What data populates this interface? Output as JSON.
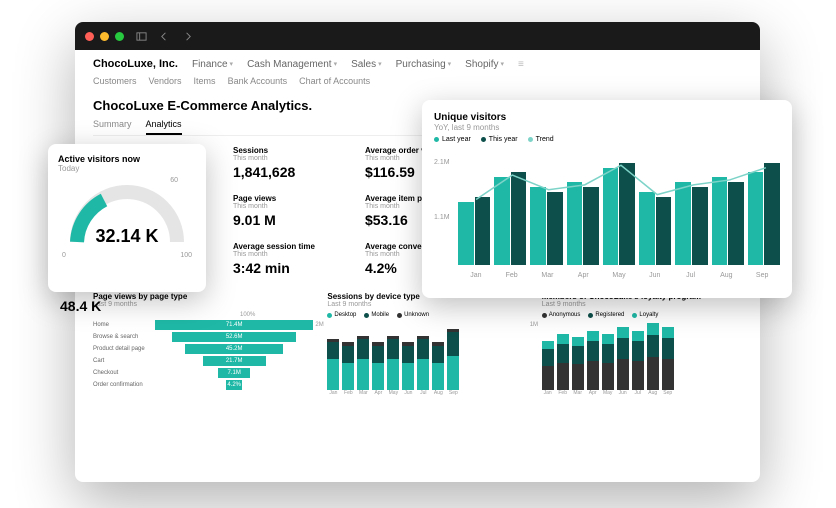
{
  "titlebar": {
    "icons": [
      "sidebar",
      "back",
      "forward"
    ],
    "right": [
      "refresh",
      "share",
      "add",
      "copy"
    ]
  },
  "company": "ChocoLuxe, Inc.",
  "nav": [
    "Finance",
    "Cash Management",
    "Sales",
    "Purchasing",
    "Shopify"
  ],
  "subnav": [
    "Customers",
    "Vendors",
    "Items",
    "Bank Accounts",
    "Chart of Accounts"
  ],
  "page_title": "ChocoLuxe E-Commerce Analytics.",
  "tabs": [
    "Summary",
    "Analytics"
  ],
  "active_tab": 1,
  "gauge": {
    "title": "Active visitors now",
    "sub": "Today",
    "value": "32.14 K",
    "min": "0",
    "mid": "60",
    "max": "100",
    "percent": 32
  },
  "metrics": {
    "col1": [
      {
        "label": "Sessions",
        "sub": "This month",
        "value": "1,841,628"
      },
      {
        "label": "Page views",
        "sub": "This month",
        "value": "9.01 M"
      },
      {
        "label": "Average session time",
        "sub": "This month",
        "value": "3:42 min"
      }
    ],
    "col2": [
      {
        "label": "Average order value",
        "sub": "This month",
        "value": "$116.59"
      },
      {
        "label": "Average item price",
        "sub": "This month",
        "value": "$53.16"
      },
      {
        "label": "Average conversion rate",
        "sub": "This month",
        "value": "4.2%"
      }
    ],
    "left_bottom": {
      "label": "",
      "sub": "",
      "value": "48.4 K"
    }
  },
  "visitors": {
    "title": "Unique visitors",
    "sub": "YoY, last 9 months",
    "legend": [
      "Last year",
      "This year",
      "Trend"
    ],
    "ytick": "2.1M",
    "ytick2": "1.1M",
    "months": [
      "Jan",
      "Feb",
      "Mar",
      "Apr",
      "May",
      "Jun",
      "Jul",
      "Aug",
      "Sep"
    ]
  },
  "funnel": {
    "title": "Page views by page type",
    "sub": "Last 9 months",
    "scale_max": "100%",
    "rows": [
      {
        "label": "Home",
        "value": "71.4M",
        "pct": 100
      },
      {
        "label": "Browse & search",
        "value": "52.6M",
        "pct": 78
      },
      {
        "label": "Product detail page",
        "value": "45.2M",
        "pct": 62
      },
      {
        "label": "Cart",
        "value": "21.7M",
        "pct": 40
      },
      {
        "label": "Checkout",
        "value": "7.1M",
        "pct": 20
      },
      {
        "label": "Order confirmation",
        "value": "4.2%",
        "pct": 10
      }
    ]
  },
  "sessions_device": {
    "title": "Sessions by device type",
    "sub": "Last 9 months",
    "legend": [
      "Desktop",
      "Mobile",
      "Unknown"
    ],
    "ylabel": "2M",
    "months": [
      "Jan",
      "Feb",
      "Mar",
      "Apr",
      "May",
      "Jun",
      "Jul",
      "Aug",
      "Sep"
    ]
  },
  "loyalty": {
    "title": "Members of ChocoLuxe's loyalty program",
    "sub": "Last 9 months",
    "legend": [
      "Anonymous",
      "Registered",
      "Loyalty"
    ],
    "ylabel": "1M",
    "months": [
      "Jan",
      "Feb",
      "Mar",
      "Apr",
      "May",
      "Jun",
      "Jul",
      "Aug",
      "Sep"
    ]
  },
  "chart_data": [
    {
      "type": "bar",
      "title": "Unique visitors",
      "xlabel": "",
      "ylabel": "",
      "ylim": [
        0,
        2.3
      ],
      "categories": [
        "Jan",
        "Feb",
        "Mar",
        "Apr",
        "May",
        "Jun",
        "Jul",
        "Aug",
        "Sep"
      ],
      "series": [
        {
          "name": "Last year",
          "values": [
            1.3,
            1.8,
            1.6,
            1.7,
            2.0,
            1.5,
            1.7,
            1.8,
            1.9
          ]
        },
        {
          "name": "This year",
          "values": [
            1.4,
            1.9,
            1.5,
            1.6,
            2.1,
            1.4,
            1.6,
            1.7,
            2.1
          ]
        }
      ],
      "trend": [
        1.35,
        1.85,
        1.55,
        1.65,
        2.05,
        1.45,
        1.65,
        1.75,
        2.0
      ]
    },
    {
      "type": "bar",
      "title": "Sessions by device type",
      "ylim": [
        0,
        2.0
      ],
      "categories": [
        "Jan",
        "Feb",
        "Mar",
        "Apr",
        "May",
        "Jun",
        "Jul",
        "Aug",
        "Sep"
      ],
      "series": [
        {
          "name": "Desktop",
          "values": [
            0.9,
            0.8,
            0.9,
            0.8,
            0.9,
            0.8,
            0.9,
            0.8,
            1.0
          ]
        },
        {
          "name": "Mobile",
          "values": [
            0.5,
            0.5,
            0.6,
            0.5,
            0.6,
            0.5,
            0.6,
            0.5,
            0.7
          ]
        },
        {
          "name": "Unknown",
          "values": [
            0.1,
            0.1,
            0.1,
            0.1,
            0.1,
            0.1,
            0.1,
            0.1,
            0.1
          ]
        }
      ]
    },
    {
      "type": "bar",
      "title": "Members of ChocoLuxe's loyalty program",
      "ylim": [
        0,
        1.0
      ],
      "categories": [
        "Jan",
        "Feb",
        "Mar",
        "Apr",
        "May",
        "Jun",
        "Jul",
        "Aug",
        "Sep"
      ],
      "series": [
        {
          "name": "Anonymous",
          "values": [
            0.35,
            0.4,
            0.38,
            0.42,
            0.4,
            0.45,
            0.42,
            0.48,
            0.45
          ]
        },
        {
          "name": "Registered",
          "values": [
            0.25,
            0.28,
            0.27,
            0.3,
            0.28,
            0.32,
            0.3,
            0.33,
            0.32
          ]
        },
        {
          "name": "Loyalty",
          "values": [
            0.12,
            0.14,
            0.13,
            0.15,
            0.14,
            0.16,
            0.15,
            0.17,
            0.16
          ]
        }
      ]
    },
    {
      "type": "bar",
      "title": "Page views by page type",
      "categories": [
        "Home",
        "Browse & search",
        "Product detail page",
        "Cart",
        "Checkout",
        "Order confirmation"
      ],
      "values": [
        71.4,
        52.6,
        45.2,
        21.7,
        7.1,
        3.0
      ]
    }
  ]
}
